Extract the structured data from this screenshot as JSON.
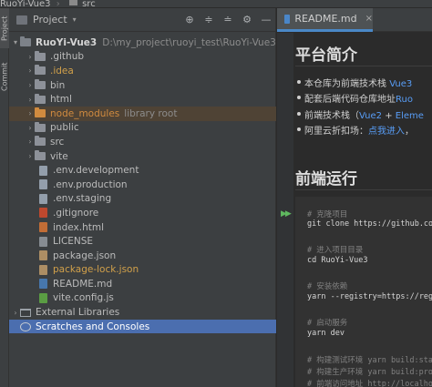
{
  "breadcrumb": {
    "project": "RuoYi-Vue3",
    "folder": "src"
  },
  "toolstrip": {
    "project_label": "Project",
    "commit_label": "Commit"
  },
  "panel": {
    "title": "Project",
    "caret": "▾",
    "tool_icons": [
      "target-icon",
      "expand-all-icon",
      "collapse-all-icon",
      "settings-icon",
      "hide-icon"
    ],
    "tool_glyphs": [
      "⊕",
      "≑",
      "≐",
      "⚙",
      "—"
    ]
  },
  "tree": {
    "root": {
      "name": "RuoYi-Vue3",
      "path": "D:\\my_project\\ruoyi_test\\RuoYi-Vue3"
    },
    "items": [
      {
        "label": ".github",
        "kind": "folder"
      },
      {
        "label": ".idea",
        "kind": "folder-yellow"
      },
      {
        "label": "bin",
        "kind": "folder"
      },
      {
        "label": "html",
        "kind": "folder"
      },
      {
        "label": "node_modules",
        "kind": "folder-excluded",
        "hint": "library root"
      },
      {
        "label": "public",
        "kind": "folder"
      },
      {
        "label": "src",
        "kind": "folder"
      },
      {
        "label": "vite",
        "kind": "folder"
      },
      {
        "label": ".env.development",
        "kind": "file"
      },
      {
        "label": ".env.production",
        "kind": "file"
      },
      {
        "label": ".env.staging",
        "kind": "file"
      },
      {
        "label": ".gitignore",
        "kind": "file-git"
      },
      {
        "label": "index.html",
        "kind": "file-html"
      },
      {
        "label": "LICENSE",
        "kind": "file-lic"
      },
      {
        "label": "package.json",
        "kind": "file-json"
      },
      {
        "label": "package-lock.json",
        "kind": "file-json-yellow"
      },
      {
        "label": "README.md",
        "kind": "file-md"
      },
      {
        "label": "vite.config.js",
        "kind": "file-js"
      }
    ],
    "external_libraries": "External Libraries",
    "scratches": "Scratches and Consoles"
  },
  "editor": {
    "tab_label": "README.md",
    "tab_close": "×",
    "heading1": "平台简介",
    "bullets": [
      {
        "pre": "本仓库为前端技术栈 ",
        "link": "Vue3",
        "post": ""
      },
      {
        "pre": "配套后端代码仓库地址",
        "link": "Ruo",
        "post": ""
      },
      {
        "pre": "前端技术栈（",
        "link": "Vue2",
        "post": " + ",
        "link2": "Eleme"
      },
      {
        "pre": "阿里云折扣场：",
        "link": "点我进入",
        "post": "，"
      }
    ],
    "heading2": "前端运行",
    "run_glyph": "▶▶",
    "code_lines": [
      {
        "text": "# 克隆项目",
        "type": "c"
      },
      {
        "text": "git clone https://github.com/",
        "type": "k"
      },
      {
        "text": "",
        "type": "k"
      },
      {
        "text": "# 进入项目目录",
        "type": "c"
      },
      {
        "text": "cd RuoYi-Vue3",
        "type": "k"
      },
      {
        "text": "",
        "type": "k"
      },
      {
        "text": "# 安装依赖",
        "type": "c"
      },
      {
        "text": "yarn --registry=https://regis",
        "type": "k"
      },
      {
        "text": "",
        "type": "k"
      },
      {
        "text": "# 启动服务",
        "type": "c"
      },
      {
        "text": "yarn dev",
        "type": "k"
      },
      {
        "text": "",
        "type": "k"
      },
      {
        "text": "# 构建测试环境 yarn build:stag",
        "type": "c"
      },
      {
        "text": "# 构建生产环境 yarn build:prod",
        "type": "c"
      },
      {
        "text": "# 前端访问地址 http://localhost",
        "type": "c"
      }
    ]
  },
  "colors": {
    "accent": "#4b6eaf",
    "link": "#589df6",
    "excluded": "#d18b3f",
    "tab_underline": "#4a88c7"
  }
}
